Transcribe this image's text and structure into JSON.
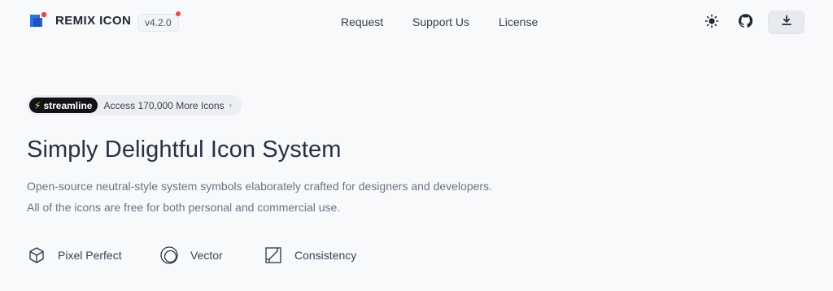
{
  "brand": {
    "name": "REMIX ICON",
    "version": "v4.2.0",
    "accent": "#2f6fe4",
    "badge_color": "#e5484d"
  },
  "nav": {
    "items": [
      {
        "label": "Request"
      },
      {
        "label": "Support Us"
      },
      {
        "label": "License"
      }
    ]
  },
  "toolbar": {
    "theme_icon": "sun-icon",
    "github_icon": "github-icon",
    "download_icon": "download-icon"
  },
  "promo": {
    "badge_label": "streamline",
    "text": "Access 170,000 More Icons",
    "chevron": "›"
  },
  "hero": {
    "title": "Simply Delightful Icon System",
    "description_line1": "Open-source neutral-style system symbols elaborately crafted for designers and developers.",
    "description_line2": "All of the icons are free for both personal and commercial use."
  },
  "features": [
    {
      "label": "Pixel Perfect",
      "icon": "cube-icon"
    },
    {
      "label": "Vector",
      "icon": "circle-icon"
    },
    {
      "label": "Consistency",
      "icon": "grid-square-icon"
    }
  ]
}
